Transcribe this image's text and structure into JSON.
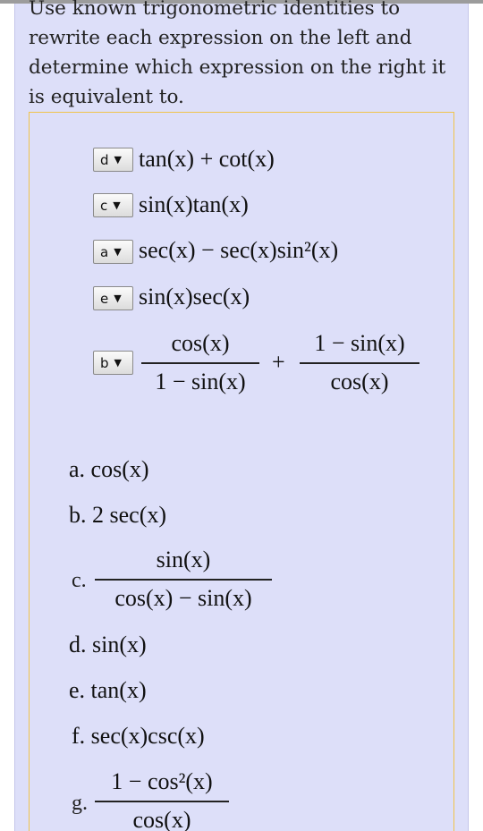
{
  "intro_text": "Use known trigonometric identities to rewrite each expression on the left and determine which expression on the right it is equivalent to.",
  "questions": [
    {
      "selected": "d",
      "expr": "tan(x) + cot(x)"
    },
    {
      "selected": "c",
      "expr": "sin(x)tan(x)"
    },
    {
      "selected": "a",
      "expr": "sec(x) − sec(x)sin²(x)"
    },
    {
      "selected": "e",
      "expr": "sin(x)sec(x)"
    },
    {
      "selected": "b",
      "expr": {
        "frac1": {
          "num": "cos(x)",
          "den": "1 − sin(x)"
        },
        "operator": "+",
        "frac2": {
          "num": "1 − sin(x)",
          "den": "cos(x)"
        }
      }
    }
  ],
  "options": [
    {
      "letter": "a.",
      "expr": "cos(x)"
    },
    {
      "letter": "b.",
      "expr": "2 sec(x)"
    },
    {
      "letter": "c.",
      "num": "sin(x)",
      "den": "cos(x) − sin(x)"
    },
    {
      "letter": "d.",
      "expr": "sin(x)"
    },
    {
      "letter": "e.",
      "expr": "tan(x)"
    },
    {
      "letter": "f.",
      "expr": "sec(x)csc(x)"
    },
    {
      "letter": "g.",
      "num": "1 − cos²(x)",
      "den": "cos(x)"
    }
  ],
  "colors": {
    "panel_bg": "#dddff9",
    "box_border": "#f0c44c",
    "top_bar": "#9c9c9c"
  }
}
